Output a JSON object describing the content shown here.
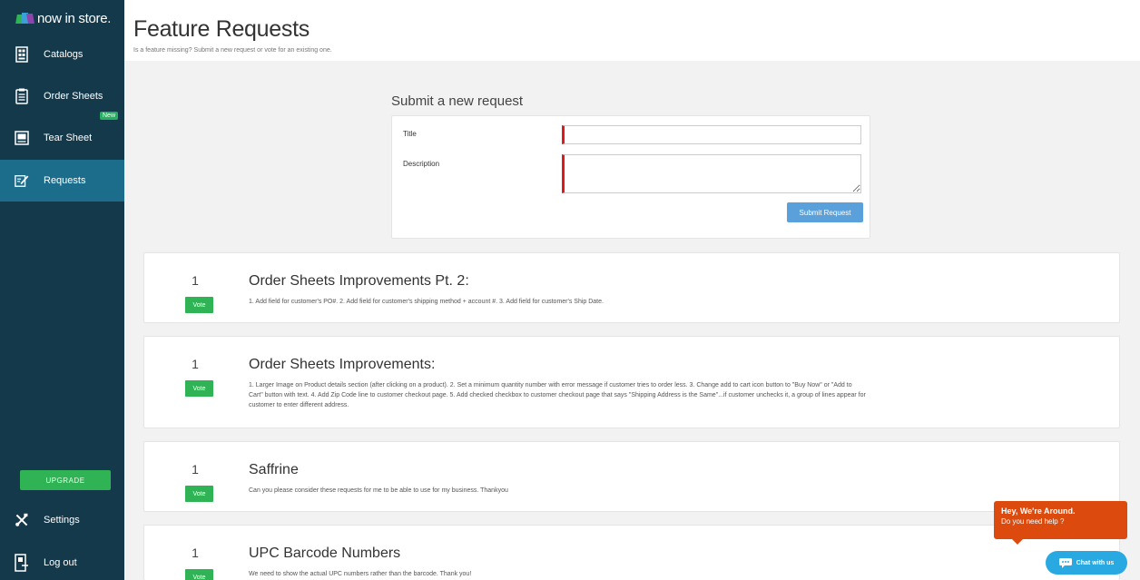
{
  "app": {
    "logo_text": "now in store."
  },
  "sidebar": {
    "items": [
      {
        "label": "Catalogs",
        "icon": "catalog-icon"
      },
      {
        "label": "Order Sheets",
        "icon": "order-sheet-icon"
      },
      {
        "label": "Tear Sheet",
        "icon": "tear-sheet-icon",
        "badge": "New"
      },
      {
        "label": "Requests",
        "icon": "requests-icon",
        "active": true
      }
    ],
    "upgrade_label": "UPGRADE",
    "settings_label": "Settings",
    "logout_label": "Log out"
  },
  "header": {
    "title": "Feature Requests",
    "subtitle": "Is a feature missing? Submit a new request or vote for an existing one."
  },
  "form": {
    "heading": "Submit a new request",
    "title_label": "Title",
    "title_value": "",
    "description_label": "Description",
    "description_value": "",
    "submit_label": "Submit Request"
  },
  "requests": [
    {
      "count": "1",
      "vote_label": "Vote",
      "title": "Order Sheets Improvements Pt. 2:",
      "description": "1. Add field for customer's PO#. 2. Add field for customer's shipping method + account #. 3. Add field for customer's Ship Date."
    },
    {
      "count": "1",
      "vote_label": "Vote",
      "title": "Order Sheets Improvements:",
      "description": "1. Larger Image on Product details section (after clicking on a product). 2. Set a minimum quantity number with error message if customer tries to order less. 3. Change add to cart icon button to \"Buy Now\" or \"Add to Cart\" button with text. 4. Add Zip Code line to customer checkout page. 5. Add checked checkbox to customer checkout page that says \"Shipping Address is the Same\"...if customer unchecks it, a group of lines appear for customer to enter different address."
    },
    {
      "count": "1",
      "vote_label": "Vote",
      "title": "Saffrine",
      "description": "Can you please consider these requests for me to be able to use for my business. Thankyou"
    },
    {
      "count": "1",
      "vote_label": "Vote",
      "title": "UPC Barcode Numbers",
      "description": "We need to show the actual UPC numbers rather than the barcode. Thank you!"
    }
  ],
  "chat": {
    "heading": "Hey, We're Around.",
    "subheading": "Do you need help ?",
    "button_label": "Chat with us"
  },
  "colors": {
    "sidebar_bg": "#14394a",
    "active_item": "#1c6d8b",
    "vote_green": "#2fb354",
    "submit_blue": "#5aa1dc",
    "chat_orange": "#dd4a0e",
    "chat_blue": "#28a9e2",
    "required_red": "#e0191f"
  }
}
